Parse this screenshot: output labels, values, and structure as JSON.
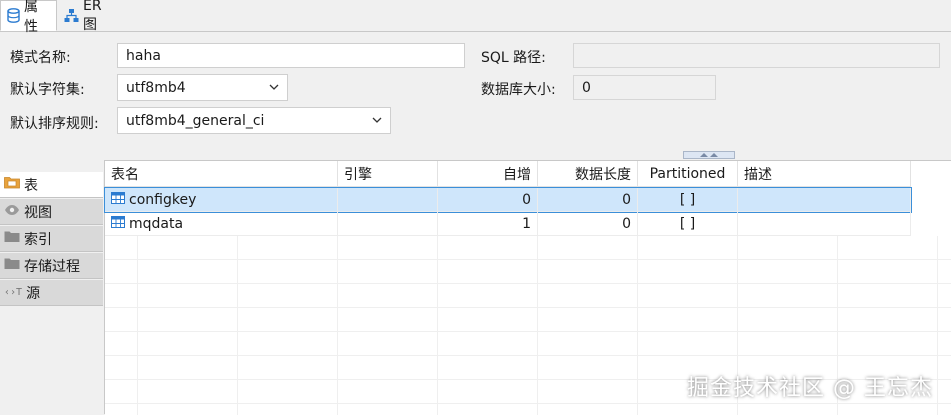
{
  "tabs": [
    {
      "label": "属性",
      "icon": "database-icon",
      "active": true
    },
    {
      "label": "ER 图",
      "icon": "er-diagram-icon",
      "active": false
    }
  ],
  "form": {
    "schema_name_label": "模式名称:",
    "schema_name_value": "haha",
    "sql_path_label": "SQL 路径:",
    "sql_path_value": "",
    "charset_label": "默认字符集:",
    "charset_value": "utf8mb4",
    "db_size_label": "数据库大小:",
    "db_size_value": "0",
    "collation_label": "默认排序规则:",
    "collation_value": "utf8mb4_general_ci"
  },
  "nav": [
    {
      "label": "表",
      "icon": "table-folder-icon",
      "active": true
    },
    {
      "label": "视图",
      "icon": "eye-icon",
      "active": false
    },
    {
      "label": "索引",
      "icon": "folder-icon",
      "active": false
    },
    {
      "label": "存储过程",
      "icon": "folder-icon",
      "active": false
    },
    {
      "label": "源",
      "icon": "source-icon",
      "active": false
    }
  ],
  "table": {
    "columns": [
      "表名",
      "引擎",
      "自增",
      "数据长度",
      "Partitioned",
      "描述"
    ],
    "rows": [
      {
        "name": "configkey",
        "engine": "",
        "auto_inc": "0",
        "data_length": "0",
        "partitioned": "[ ]",
        "desc": "",
        "selected": true
      },
      {
        "name": "mqdata",
        "engine": "",
        "auto_inc": "1",
        "data_length": "0",
        "partitioned": "[ ]",
        "desc": "",
        "selected": false
      }
    ]
  },
  "watermark": "掘金技术社区 @ 王忘杰",
  "colors": {
    "accent": "#3b8fd9",
    "selection": "#cfe6fb",
    "icon_blue": "#2b7bd0",
    "folder_gray": "#8a8a8a"
  }
}
